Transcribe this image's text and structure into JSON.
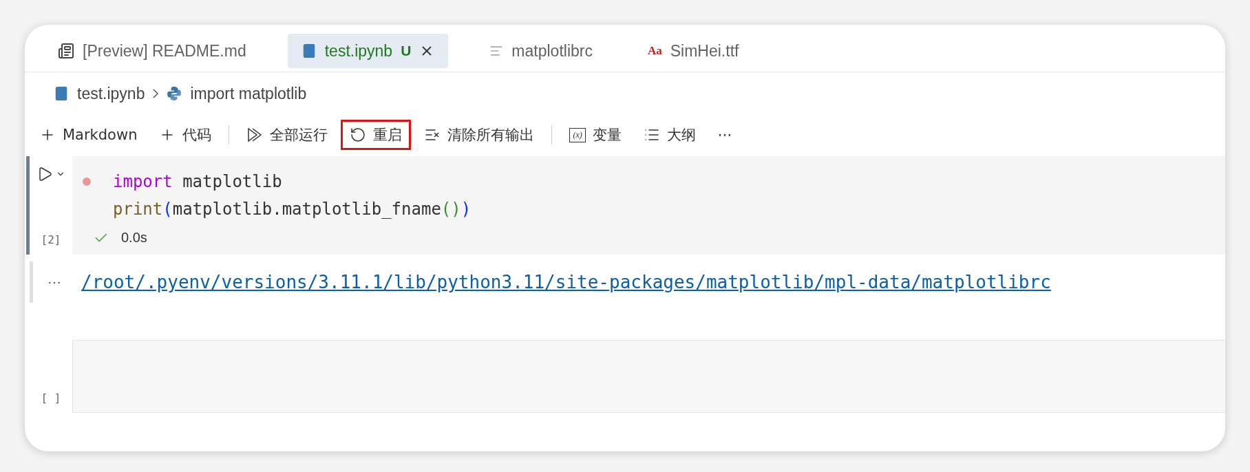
{
  "tabs": [
    {
      "label": "[Preview] README.md",
      "kind": "preview",
      "selected": false
    },
    {
      "label": "test.ipynb",
      "kind": "notebook",
      "selected": true,
      "badge": "U",
      "closable": true
    },
    {
      "label": "matplotlibrc",
      "kind": "text",
      "selected": false
    },
    {
      "label": "SimHei.ttf",
      "kind": "font",
      "icon_glyph": "Aa",
      "selected": false
    }
  ],
  "breadcrumb": [
    {
      "label": "test.ipynb",
      "kind": "notebook"
    },
    {
      "label": "import matplotlib",
      "kind": "python"
    }
  ],
  "toolbar": [
    {
      "label": "Markdown",
      "kind": "add",
      "highlighted": false
    },
    {
      "label": "代码",
      "kind": "add",
      "highlighted": false
    },
    {
      "kind": "separator"
    },
    {
      "label": "全部运行",
      "kind": "run-all",
      "highlighted": false
    },
    {
      "label": "重启",
      "kind": "restart",
      "highlighted": true
    },
    {
      "label": "清除所有输出",
      "kind": "clear",
      "highlighted": false
    },
    {
      "kind": "separator"
    },
    {
      "label": "变量",
      "kind": "variables",
      "icon_glyph": "(x)",
      "highlighted": false
    },
    {
      "label": "大纲",
      "kind": "outline",
      "highlighted": false
    },
    {
      "label": "⋯",
      "kind": "more",
      "highlighted": false
    }
  ],
  "cells": [
    {
      "execution_count": "[2]",
      "selected": true,
      "lines": [
        [
          {
            "text": "import",
            "color": "#af00db"
          },
          {
            "text": " matplotlib",
            "color": "#333333"
          }
        ],
        [
          {
            "text": "print",
            "color": "#795e26"
          },
          {
            "text": "(",
            "color": "#0431fa"
          },
          {
            "text": "matplotlib.matplotlib_fname",
            "color": "#333333"
          },
          {
            "text": "()",
            "color": "#319331"
          },
          {
            "text": ")",
            "color": "#0431fa"
          }
        ]
      ],
      "status": {
        "success": true,
        "time": "0.0s"
      },
      "output": {
        "marker": "⋯",
        "link": "/root/.pyenv/versions/3.11.1/lib/python3.11/site-packages/matplotlib/mpl-data/matplotlibrc"
      }
    },
    {
      "execution_count": "[ ]",
      "selected": false
    }
  ]
}
